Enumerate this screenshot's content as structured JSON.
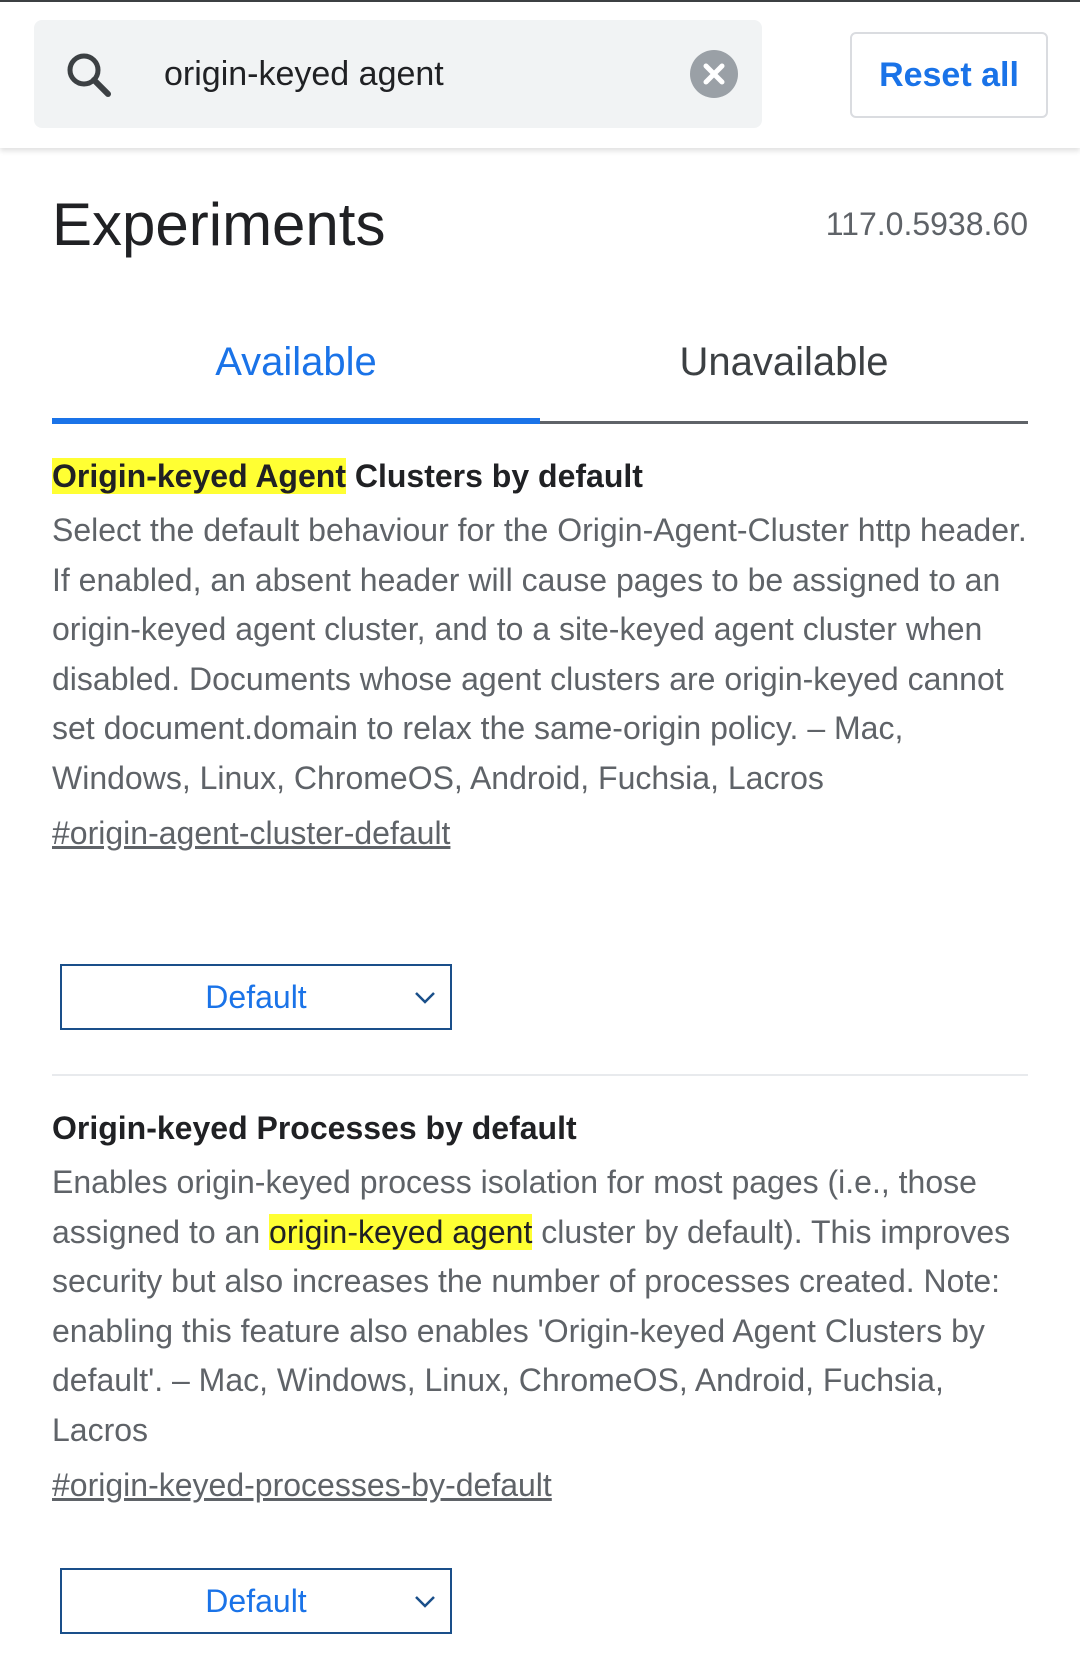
{
  "search": {
    "query": "origin-keyed agent",
    "reset_label": "Reset all"
  },
  "header": {
    "title": "Experiments",
    "version": "117.0.5938.60"
  },
  "tabs": [
    {
      "label": "Available",
      "active": true
    },
    {
      "label": "Unavailable",
      "active": false
    }
  ],
  "experiments": [
    {
      "title_highlight": "Origin-keyed Agent",
      "title_rest": " Clusters by default",
      "description": "Select the default behaviour for the Origin-Agent-Cluster http header. If enabled, an absent header will cause pages to be assigned to an origin-keyed agent cluster, and to a site-keyed agent cluster when disabled. Documents whose agent clusters are origin-keyed cannot set document.domain to relax the same-origin policy. – Mac, Windows, Linux, ChromeOS, Android, Fuchsia, Lacros",
      "link": "#origin-agent-cluster-default",
      "select_value": "Default"
    },
    {
      "title": "Origin-keyed Processes by default",
      "desc_before": "Enables origin-keyed process isolation for most pages (i.e., those assigned to an ",
      "desc_highlight": "origin-keyed agent",
      "desc_after": " cluster by default). This improves security but also increases the number of processes created. Note: enabling this feature also enables 'Origin-keyed Agent Clusters by default'. – Mac, Windows, Linux, ChromeOS, Android, Fuchsia, Lacros",
      "link": "#origin-keyed-processes-by-default",
      "select_value": "Default"
    }
  ],
  "colors": {
    "accent": "#1a73e8",
    "highlight": "#ffff33",
    "text_secondary": "#5f6368"
  }
}
